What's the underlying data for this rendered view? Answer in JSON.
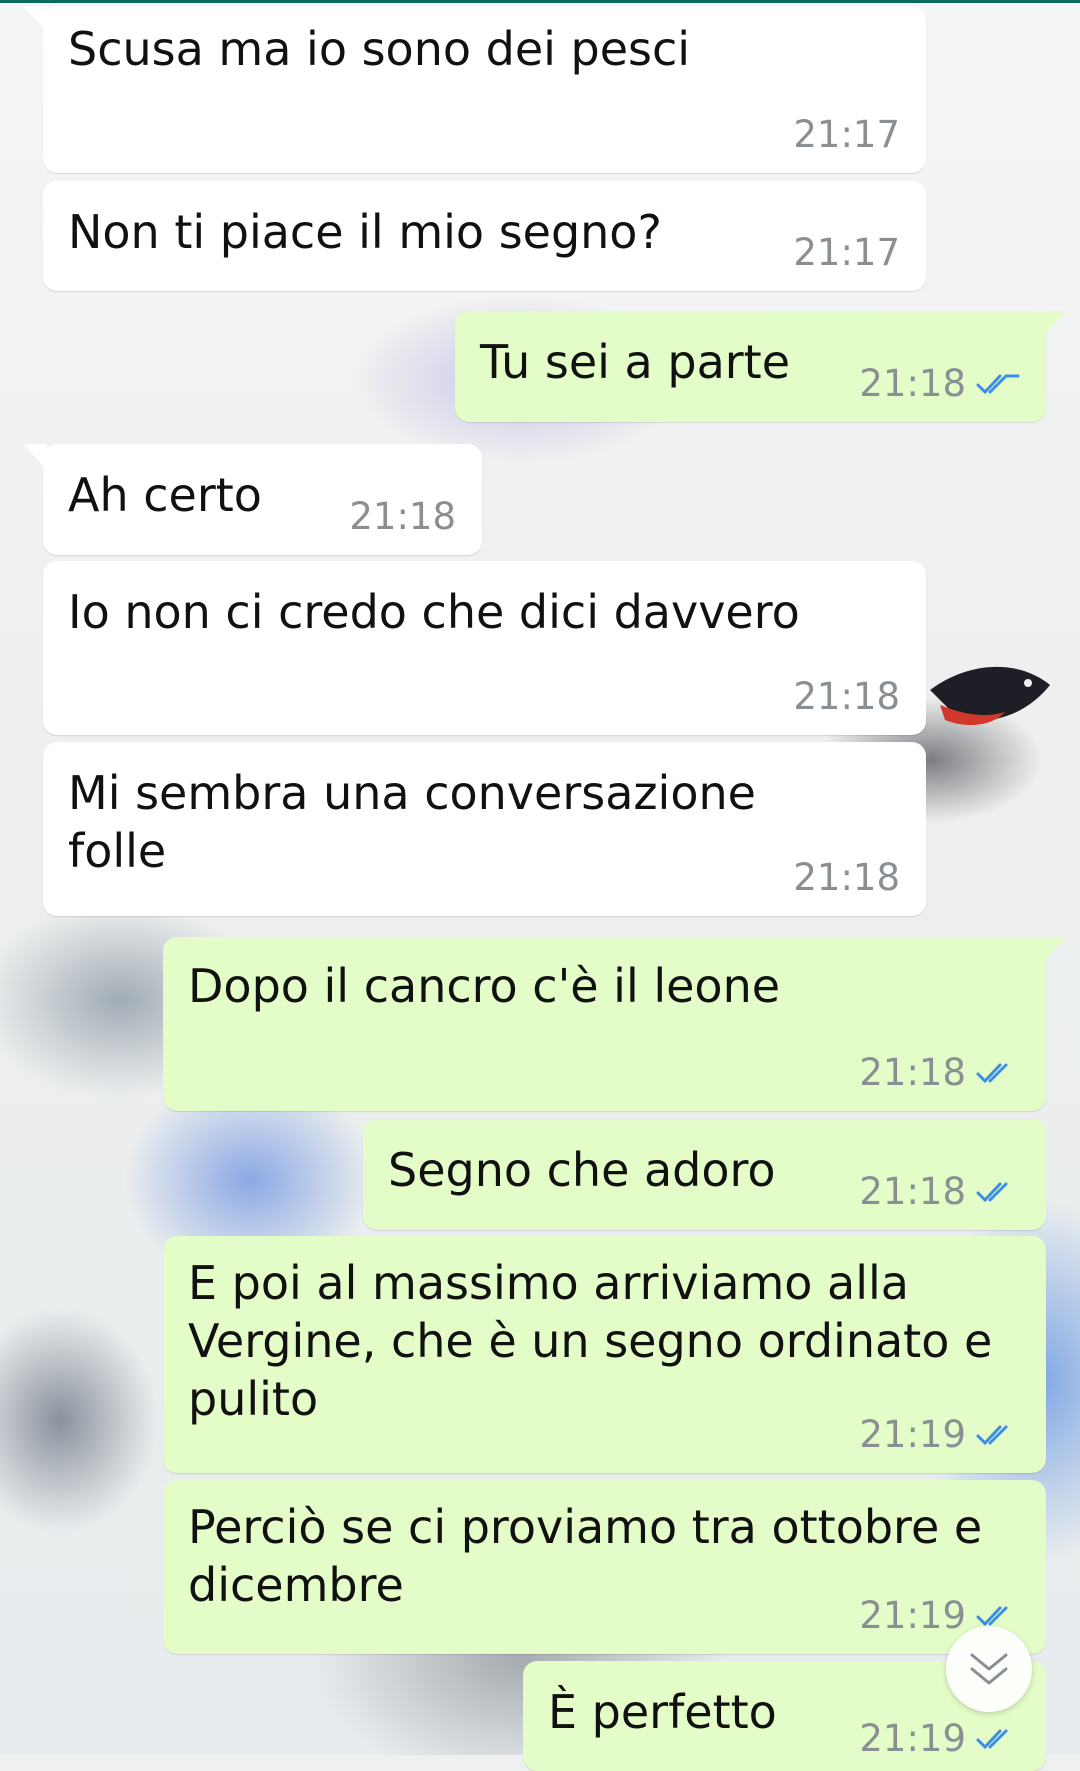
{
  "messages": [
    {
      "direction": "in",
      "text": "Scusa ma io sono dei pesci",
      "time": "21:17"
    },
    {
      "direction": "in",
      "text": "Non ti piace il mio segno?",
      "time": "21:17"
    },
    {
      "direction": "out",
      "text": "Tu sei a parte",
      "time": "21:18",
      "status": "read"
    },
    {
      "direction": "in",
      "text": "Ah certo",
      "time": "21:18"
    },
    {
      "direction": "in",
      "text": "Io non ci credo che dici davvero",
      "time": "21:18"
    },
    {
      "direction": "in",
      "text": "Mi sembra una conversazione folle",
      "time": "21:18"
    },
    {
      "direction": "out",
      "text": "Dopo il cancro c'è il leone",
      "time": "21:18",
      "status": "read"
    },
    {
      "direction": "out",
      "text": "Segno che adoro",
      "time": "21:18",
      "status": "read"
    },
    {
      "direction": "out",
      "text": "E poi al massimo arriviamo alla Vergine, che è un segno ordinato e pulito",
      "time": "21:19",
      "status": "read"
    },
    {
      "direction": "out",
      "text": "Perciò se ci proviamo tra ottobre e dicembre",
      "time": "21:19",
      "status": "read"
    },
    {
      "direction": "out",
      "text": "È perfetto",
      "time": "21:19",
      "status": "read"
    }
  ],
  "icons": {
    "read_receipt": "double-check-icon",
    "scroll": "chevron-double-down-icon"
  },
  "colors": {
    "incoming_bubble": "#ffffff",
    "outgoing_bubble": "#e4fcc8",
    "read_tick": "#3a8ee6",
    "timestamp": "#8a8f93"
  }
}
